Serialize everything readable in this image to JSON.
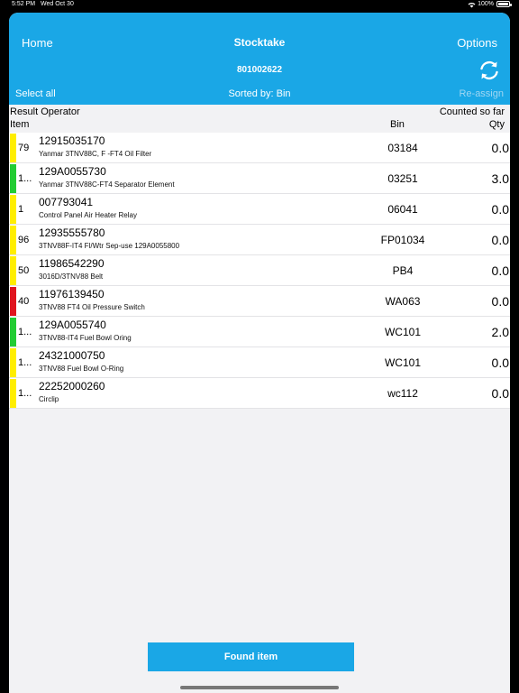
{
  "status_bar": {
    "time": "5:52 PM",
    "date": "Wed Oct 30",
    "battery": "100%",
    "battery_level": 1.0
  },
  "header": {
    "home_label": "Home",
    "title": "Stocktake",
    "options_label": "Options",
    "stocktake_number": "801002622",
    "select_all_label": "Select all",
    "sorted_label": "Sorted by: Bin",
    "reassign_label": "Re-assign"
  },
  "columns": {
    "result_operator": "Result Operator",
    "counted_so_far": "Counted so far",
    "item": "Item",
    "bin": "Bin",
    "qty": "Qty"
  },
  "colors": {
    "accent": "#1aa7e6",
    "yellow": "#ffee00",
    "green": "#22cc33",
    "red": "#e0141e"
  },
  "rows": [
    {
      "status": "yellow",
      "result": "79",
      "code": "12915035170",
      "description": "Yanmar 3TNV88C, F -FT4 Oil Filter",
      "bin": "03184",
      "qty": "0.0"
    },
    {
      "status": "green",
      "result": "1...",
      "code": "129A0055730",
      "description": "Yanmar 3TNV88C-FT4 Separator Element",
      "bin": "03251",
      "qty": "3.0"
    },
    {
      "status": "yellow",
      "result": "1",
      "code": "007793041",
      "description": "Control Panel Air Heater Relay",
      "bin": "06041",
      "qty": "0.0"
    },
    {
      "status": "yellow",
      "result": "96",
      "code": "12935555780",
      "description": "3TNV88F-IT4 Fl/Wtr Sep-use 129A0055800",
      "bin": "FP01034",
      "qty": "0.0"
    },
    {
      "status": "yellow",
      "result": "50",
      "code": "11986542290",
      "description": "3016D/3TNV88 Belt",
      "bin": "PB4",
      "qty": "0.0"
    },
    {
      "status": "red",
      "result": "40",
      "code": "11976139450",
      "description": "3TNV88 FT4 Oil Pressure Switch",
      "bin": "WA063",
      "qty": "0.0"
    },
    {
      "status": "green",
      "result": "1...",
      "code": "129A0055740",
      "description": "3TNV88-IT4 Fuel Bowl Oring",
      "bin": "WC101",
      "qty": "2.0"
    },
    {
      "status": "yellow",
      "result": "1...",
      "code": "24321000750",
      "description": "3TNV88 Fuel Bowl O-Ring",
      "bin": "WC101",
      "qty": "0.0"
    },
    {
      "status": "yellow",
      "result": "1...",
      "code": "22252000260",
      "description": "Circlip",
      "bin": "wc112",
      "qty": "0.0"
    }
  ],
  "footer": {
    "found_item_label": "Found item"
  }
}
